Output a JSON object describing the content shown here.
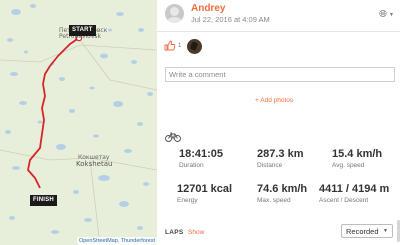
{
  "map": {
    "labels": [
      "Петропавловск",
      "Petropavlovsk",
      "Кокшетау",
      "Kokshetau"
    ],
    "start_label": "START",
    "finish_label": "FINISH",
    "attribution_links": [
      "OpenStreetMap",
      "Thunderforest"
    ],
    "route_color": "#d6242a"
  },
  "header": {
    "athlete_name": "Andrey",
    "date": "Jul 22, 2016 at 4:09 AM",
    "privacy_icon": "globe-icon"
  },
  "kudos": {
    "icon": "thumbs-up-icon",
    "count": "1"
  },
  "comment": {
    "placeholder": "Write a comment"
  },
  "add_photos_label": "+ Add photos",
  "activity_icon": "bicycle-icon",
  "stats": [
    {
      "value": "18:41:05",
      "label": "Duration"
    },
    {
      "value": "287.3 km",
      "label": "Distance"
    },
    {
      "value": "15.4 km/h",
      "label": "Avg. speed"
    },
    {
      "value": "12701 kcal",
      "label": "Energy"
    },
    {
      "value": "74.6 km/h",
      "label": "Max. speed"
    },
    {
      "value": "4411 / 4194 m",
      "label": "Ascent / Descent"
    }
  ],
  "laps": {
    "label": "LAPS",
    "show_label": "Show",
    "mode_selected": "Recorded"
  },
  "colors": {
    "accent": "#f26d3c",
    "route": "#d6242a"
  }
}
